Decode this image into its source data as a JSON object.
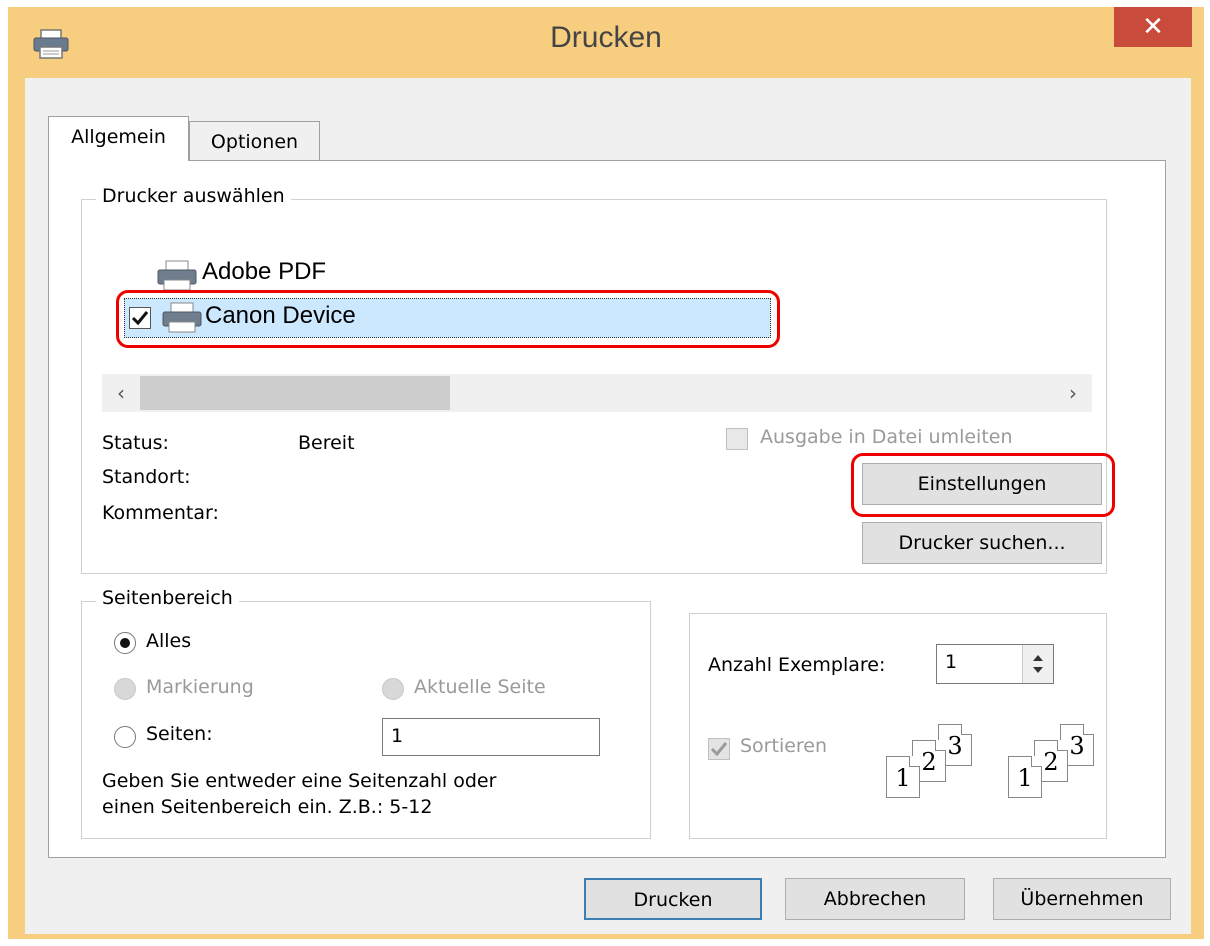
{
  "window": {
    "title": "Drucken",
    "close_glyph": "✕"
  },
  "tabs": [
    {
      "label": "Allgemein"
    },
    {
      "label": "Optionen"
    }
  ],
  "printer_group": {
    "legend": "Drucker auswählen",
    "printers": [
      {
        "name": "Adobe PDF"
      },
      {
        "name": "Canon Device"
      }
    ],
    "status_label": "Status:",
    "status_value": "Bereit",
    "location_label": "Standort:",
    "comment_label": "Kommentar:",
    "print_to_file_label": "Ausgabe in Datei umleiten",
    "settings_button": "Einstellungen",
    "find_printer_button": "Drucker suchen..."
  },
  "page_range": {
    "legend": "Seitenbereich",
    "all_label": "Alles",
    "selection_label": "Markierung",
    "current_page_label": "Aktuelle Seite",
    "pages_label": "Seiten:",
    "pages_value": "1",
    "hint_line1": "Geben Sie entweder eine Seitenzahl oder",
    "hint_line2": "einen Seitenbereich ein. Z.B.: 5-12"
  },
  "copies": {
    "count_label": "Anzahl Exemplare:",
    "count_value": "1",
    "collate_label": "Sortieren",
    "page_numbers": [
      "1",
      "2",
      "3"
    ]
  },
  "buttons": {
    "print": "Drucken",
    "cancel": "Abbrechen",
    "apply": "Übernehmen"
  },
  "colors": {
    "frame": "#f7cd80",
    "close": "#c84b3c",
    "highlight": "#cce8ff",
    "annotation": "#e00000"
  }
}
